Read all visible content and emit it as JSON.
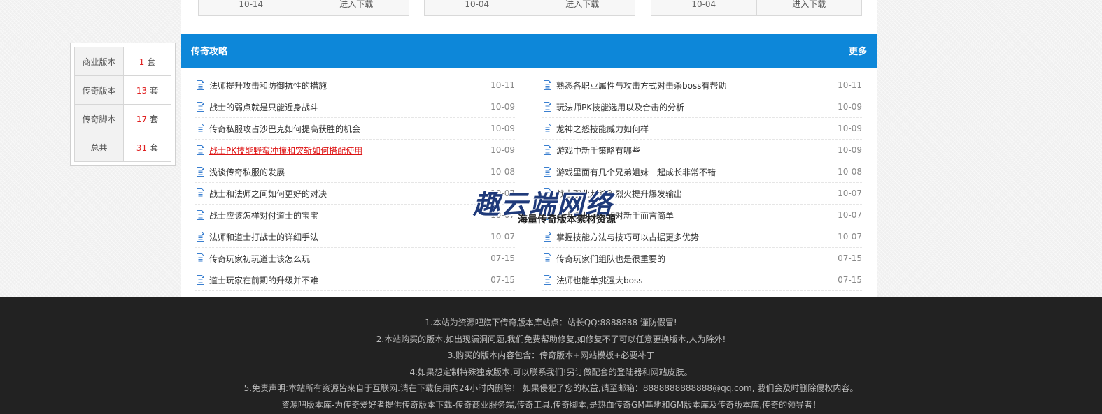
{
  "top_cards": [
    {
      "date": "10-14",
      "button": "进入下载"
    },
    {
      "date": "10-04",
      "button": "进入下载"
    },
    {
      "date": "10-04",
      "button": "进入下载"
    }
  ],
  "stats": [
    {
      "label": "商业版本",
      "count": "1",
      "unit": "套"
    },
    {
      "label": "传奇版本",
      "count": "13",
      "unit": "套"
    },
    {
      "label": "传奇脚本",
      "count": "17",
      "unit": "套"
    },
    {
      "label": "总共",
      "count": "31",
      "unit": "套"
    }
  ],
  "panel": {
    "title": "传奇攻略",
    "more": "更多",
    "left_articles": [
      {
        "title": "法师提升攻击和防御抗性的措施",
        "date": "10-11"
      },
      {
        "title": "战士的弱点就是只能近身战斗",
        "date": "10-09"
      },
      {
        "title": "传奇私服攻占沙巴克如何提高获胜的机会",
        "date": "10-09"
      },
      {
        "title": "战士PK技能野蛮冲撞和突斩如何搭配使用",
        "date": "10-09"
      },
      {
        "title": "浅谈传奇私服的发展",
        "date": "10-08"
      },
      {
        "title": "战士和法师之间如何更好的对决",
        "date": "10-07"
      },
      {
        "title": "战士应该怎样对付道士的宝宝",
        "date": "10-07"
      },
      {
        "title": "法师和道士打战士的详细手法",
        "date": "10-07"
      },
      {
        "title": "传奇玩家初玩道士该怎么玩",
        "date": "07-15"
      },
      {
        "title": "道士玩家在前期的升级并不难",
        "date": "07-15"
      }
    ],
    "right_articles": [
      {
        "title": "熟悉各职业属性与攻击方式对击杀boss有帮助",
        "date": "10-11"
      },
      {
        "title": "玩法师PK技能选用以及合击的分析",
        "date": "10-09"
      },
      {
        "title": "龙神之怒技能威力如何样",
        "date": "10-09"
      },
      {
        "title": "游戏中新手策略有哪些",
        "date": "10-09"
      },
      {
        "title": "游戏里面有几个兄弟姐妹一起成长非常不错",
        "date": "10-08"
      },
      {
        "title": "战士职业刺杀和烈火提升爆发输出",
        "date": "10-07"
      },
      {
        "title": "战士职业操作相对新手而言简单",
        "date": "10-07"
      },
      {
        "title": "掌握技能方法与技巧可以占据更多优势",
        "date": "10-07"
      },
      {
        "title": "传奇玩家们组队也是很重要的",
        "date": "07-15"
      },
      {
        "title": "法师也能单挑强大boss",
        "date": "07-15"
      }
    ]
  },
  "watermark": {
    "main": "趣云端网络",
    "sub": "海量传奇版本素材资源"
  },
  "footer": {
    "lines": [
      "1.本站为资源吧旗下传奇版本库站点：站长QQ:8888888 谨防假冒!",
      "2.本站购买的版本,如出现漏洞问题,我们免费帮助修复,如修复不了可以任意更换版本,人为除外!",
      "3.购买的版本内容包含：传奇版本+网站模板+必要补丁",
      "4.如果想定制特殊独家版本,可以联系我们!另订做配套的登陆器和网站皮肤。",
      "5.免责声明:本站所有资源皆来自于互联网.请在下载使用内24小时内删除！ 如果侵犯了您的权益,请至邮箱：8888888888888@qq.com, 我们会及时删除侵权内容。",
      "资源吧版本库-为传奇爱好者提供传奇版本下载-传奇商业服务端,传奇工具,传奇脚本,是热血传奇GM基地和GM版本库及传奇版本库,传奇的领导者！"
    ]
  },
  "colors": {
    "header_blue": "#0d87d9",
    "footer_bg": "#222222",
    "highlight_red": "#dd1111"
  }
}
